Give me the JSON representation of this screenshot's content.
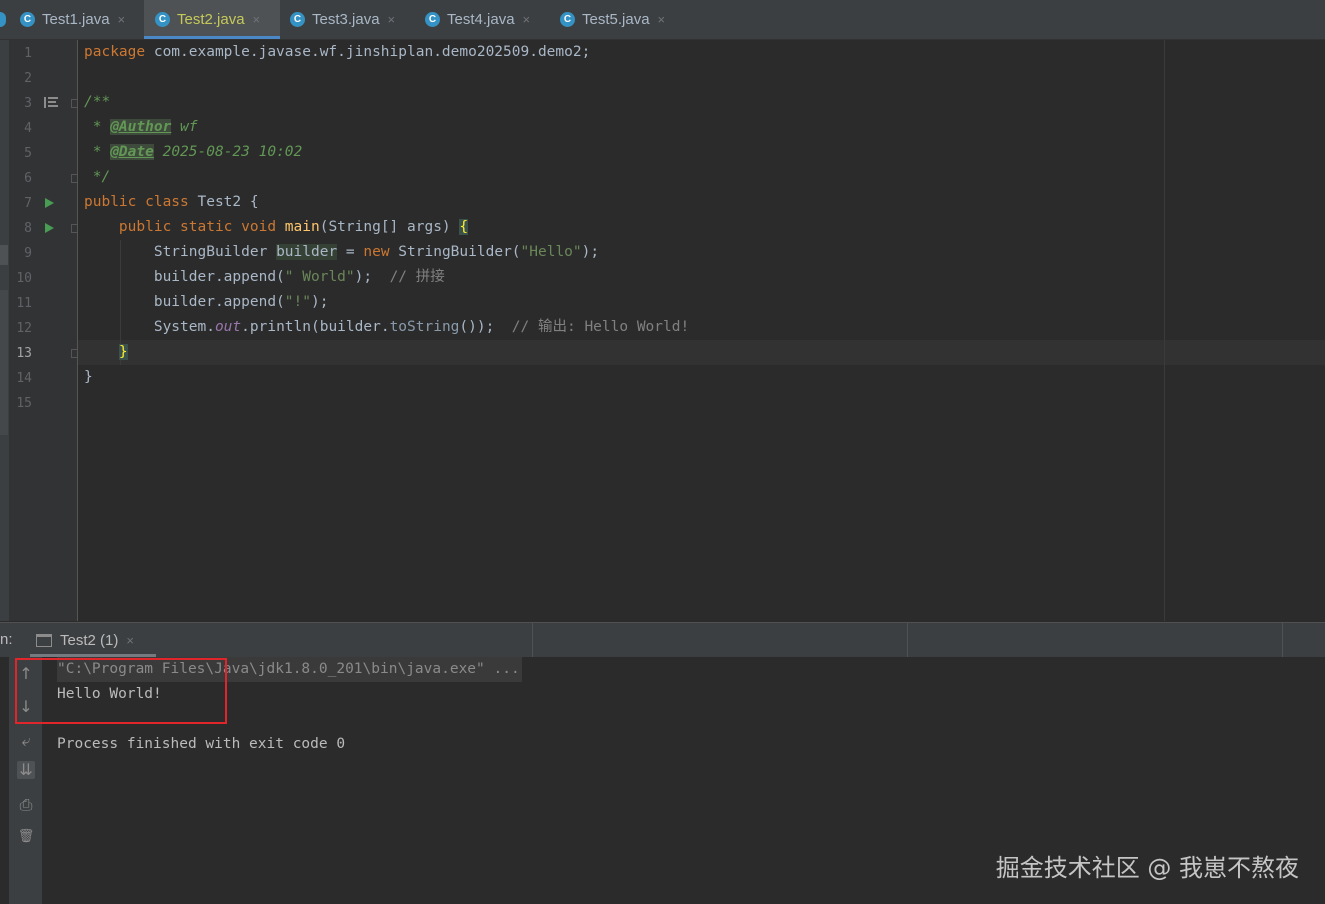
{
  "tabs": [
    {
      "label": "Test1.java",
      "active": false
    },
    {
      "label": "Test2.java",
      "active": true
    },
    {
      "label": "Test3.java",
      "active": false
    },
    {
      "label": "Test4.java",
      "active": false
    },
    {
      "label": "Test5.java",
      "active": false
    }
  ],
  "tab_icon_letter": "C",
  "close_glyph": "×",
  "line_numbers": [
    "1",
    "2",
    "3",
    "4",
    "5",
    "6",
    "7",
    "8",
    "9",
    "10",
    "11",
    "12",
    "13",
    "14",
    "15"
  ],
  "current_line": "13",
  "code": {
    "l1_kw": "package",
    "l1_rest": " com.example.javase.wf.jinshiplan.demo202509.demo2;",
    "l3": "/**",
    "l4_star": " * ",
    "l4_tag": "@Author",
    "l4_val": " wf",
    "l5_star": " * ",
    "l5_tag": "@Date",
    "l5_val": " 2025-08-23 10:02",
    "l6": " */",
    "l7_kw": "public class",
    "l7_rest": " Test2 {",
    "l8_indent": "    ",
    "l8_kw": "public static void",
    "l8_fn": " main",
    "l8_rest": "(String[] args) ",
    "l8_brace": "{",
    "l9_indent": "        ",
    "l9_a": "StringBuilder ",
    "l9_var": "builder",
    "l9_b": " = ",
    "l9_new": "new",
    "l9_c": " StringBuilder(",
    "l9_str": "\"Hello\"",
    "l9_d": ");",
    "l10_indent": "        ",
    "l10_a": "builder.append(",
    "l10_str": "\" World\"",
    "l10_b": ");  ",
    "l10_cmt": "// 拼接",
    "l11_indent": "        ",
    "l11_a": "builder.append(",
    "l11_str": "\"!\"",
    "l11_b": ");",
    "l12_indent": "        ",
    "l12_a": "System.",
    "l12_field": "out",
    "l12_b": ".println(builder.",
    "l12_m": "toString",
    "l12_c": "());  ",
    "l12_cmt": "// 输出: Hello World!",
    "l13_indent": "    ",
    "l13_brace": "}",
    "l14": "}"
  },
  "run_panel": {
    "label": "n:",
    "tab_label": "Test2 (1)",
    "console_lines": [
      "\"C:\\Program Files\\Java\\jdk1.8.0_201\\bin\\java.exe\" ...",
      "Hello World!",
      "Process finished with exit code 0"
    ],
    "toolbar_glyphs": {
      "up": "↑",
      "down": "↓",
      "wrap": "⤶",
      "scroll": "⇊",
      "print": "⎙",
      "trash": "🗑"
    }
  },
  "watermark": "掘金技术社区 @ 我崽不熬夜",
  "colors": {
    "run_green": "#499c54",
    "tab_underline": "#4a88c7",
    "highlight_box": "#e0262a"
  }
}
